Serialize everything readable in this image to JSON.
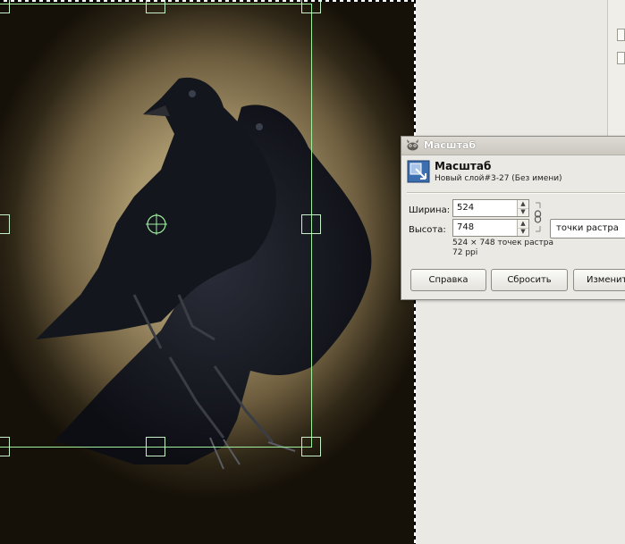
{
  "dialog": {
    "title": "Масштаб",
    "header_title": "Масштаб",
    "header_subtitle": "Новый слой#3-27 (Без имени)",
    "width_label": "Ширина:",
    "height_label": "Высота:",
    "width_value": "524",
    "height_value": "748",
    "unit_value": "точки растра",
    "size_info": "524 × 748 точек растра",
    "resolution_info": "72 ppi",
    "help_button": "Справка",
    "reset_button": "Сбросить",
    "scale_button": "Изменить"
  },
  "colors": {
    "guide": "#9ef09e",
    "dialog_bg": "#ebe9e3",
    "workspace_bg": "#ebe9e3"
  },
  "icons": {
    "titlebar": "gimp-wilber-icon",
    "header": "scale-layer-icon",
    "chain": "chain-link-icon",
    "crosshair": "crosshair-icon"
  }
}
